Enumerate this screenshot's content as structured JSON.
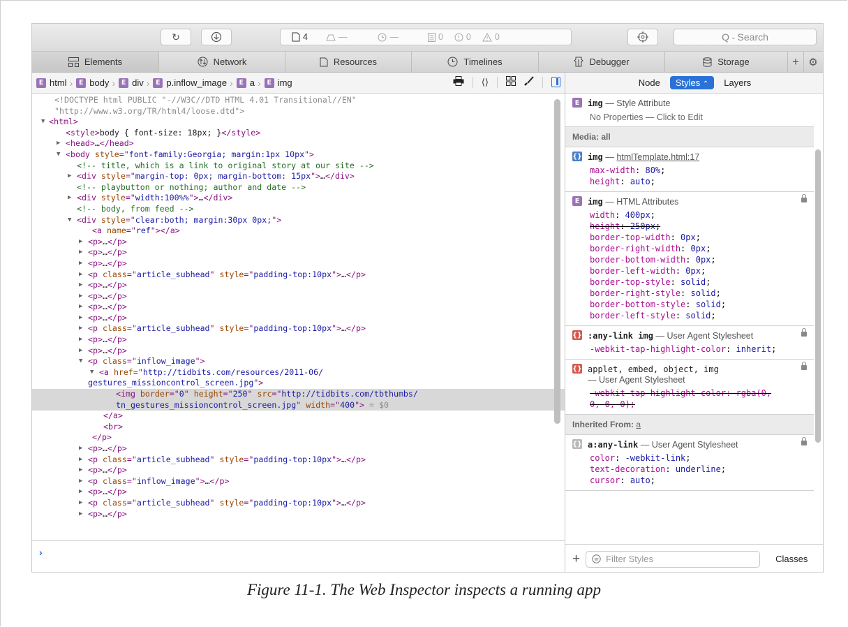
{
  "toolbar": {
    "activity": {
      "resources": "4",
      "dash1": "—",
      "dash2": "—",
      "logs": "0",
      "errors": "0",
      "warnings": "0"
    },
    "search_label": "Search"
  },
  "tabs": [
    {
      "label": "Elements",
      "icon": "elements-icon"
    },
    {
      "label": "Network",
      "icon": "network-icon"
    },
    {
      "label": "Resources",
      "icon": "resources-icon"
    },
    {
      "label": "Timelines",
      "icon": "timelines-icon"
    },
    {
      "label": "Debugger",
      "icon": "debugger-icon"
    },
    {
      "label": "Storage",
      "icon": "storage-icon"
    }
  ],
  "breadcrumb": [
    "html",
    "body",
    "div",
    "p.inflow_image",
    "a",
    "img"
  ],
  "badge_letter": "E",
  "dom": {
    "doctype1": "<!DOCTYPE html PUBLIC \"-//W3C//DTD HTML 4.01 Transitional//EN\"",
    "doctype2": "\"http://www.w3.org/TR/html4/loose.dtd\">",
    "style_text": "body { font-size: 18px; }",
    "body_style": "font-family:Georgia; margin:1px 10px",
    "comment1": "<!-- title, which is a link to original story at our site -->",
    "div1_style": "margin-top: 0px; margin-bottom: 15px",
    "comment2": "<!-- playbutton or nothing; author and date -->",
    "div2_style": "width:100%%",
    "comment3": "<!-- body, from feed -->",
    "div3_style": "clear:both; margin:30px 0px;",
    "a_name": "ref",
    "class_subhead": "article_subhead",
    "style_subhead": "padding-top:10px",
    "class_inflow": "inflow_image",
    "href1": "http://tidbits.com/resources/2011-06/",
    "href2": "gestures_missioncontrol_screen.jpg",
    "img_border": "0",
    "img_height": "250",
    "img_src1": "http://tidbits.com/tbthumbs/",
    "img_src2": "tn_gestures_missioncontrol_screen.jpg",
    "img_width": "400",
    "dollar": "= $0"
  },
  "sidebar": {
    "head": {
      "node": "Node",
      "styles": "Styles",
      "layers": "Layers"
    },
    "rule_style_attr": {
      "selector": "img",
      "origin": "— Style Attribute",
      "empty": "No Properties — Click to Edit"
    },
    "media_label": "Media: all",
    "rule_template": {
      "selector": "img",
      "dash": "—",
      "origin": "htmlTemplate.html:17",
      "props": [
        {
          "name": "max-width",
          "value": "80%"
        },
        {
          "name": "height",
          "value": "auto"
        }
      ]
    },
    "rule_html_attrs": {
      "selector": "img",
      "origin": "— HTML Attributes",
      "props": [
        {
          "name": "width",
          "value": "400px",
          "struck": false
        },
        {
          "name": "height",
          "value": "250px",
          "struck": true
        },
        {
          "name": "border-top-width",
          "value": "0px",
          "struck": false
        },
        {
          "name": "border-right-width",
          "value": "0px",
          "struck": false
        },
        {
          "name": "border-bottom-width",
          "value": "0px",
          "struck": false
        },
        {
          "name": "border-left-width",
          "value": "0px",
          "struck": false
        },
        {
          "name": "border-top-style",
          "value": "solid",
          "struck": false
        },
        {
          "name": "border-right-style",
          "value": "solid",
          "struck": false
        },
        {
          "name": "border-bottom-style",
          "value": "solid",
          "struck": false
        },
        {
          "name": "border-left-style",
          "value": "solid",
          "struck": false
        }
      ]
    },
    "rule_anylink": {
      "selector": ":any-link img",
      "origin": "— User Agent Stylesheet",
      "props": [
        {
          "name": "-webkit-tap-highlight-color",
          "value": "inherit"
        }
      ]
    },
    "rule_applet": {
      "selector": "applet, embed, object, img",
      "origin": "— User Agent Stylesheet",
      "prop_line1": "-webkit-tap-highlight-color: rgba(0,",
      "prop_line2": "0, 0, 0);"
    },
    "inherited_label": "Inherited From:",
    "inherited_from": "a",
    "rule_a": {
      "selector": "a:any-link",
      "origin": "— User Agent Stylesheet",
      "props": [
        {
          "name": "color",
          "value": "-webkit-link"
        },
        {
          "name": "text-decoration",
          "value": "underline"
        },
        {
          "name": "cursor",
          "value": "auto"
        }
      ]
    },
    "filter_placeholder": "Filter Styles",
    "classes_label": "Classes"
  },
  "caption": "Figure 11-1. The Web Inspector inspects a running app"
}
